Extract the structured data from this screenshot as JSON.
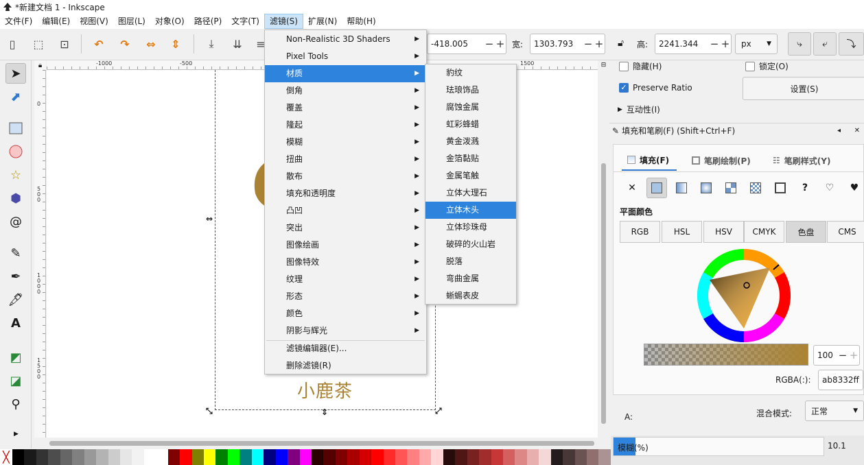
{
  "window": {
    "title": "*新建文档 1 - Inkscape"
  },
  "menubar": [
    "文件(F)",
    "编辑(E)",
    "视图(V)",
    "图层(L)",
    "对象(O)",
    "路径(P)",
    "文字(T)",
    "滤镜(S)",
    "扩展(N)",
    "帮助(H)"
  ],
  "toolbar": {
    "x_value": "-418.005",
    "w_label": "宽:",
    "w_value": "1303.793",
    "h_label": "高:",
    "h_value": "2241.344",
    "unit": "px"
  },
  "rulers": {
    "h_ticks": [
      "-1000",
      "-500",
      "1500"
    ],
    "v_ticks": [
      "0",
      "500",
      "1000",
      "1500"
    ]
  },
  "canvas": {
    "text": "小鹿茶"
  },
  "filters_menu": {
    "items": [
      "Non-Realistic 3D Shaders",
      "Pixel Tools",
      "材质",
      "倒角",
      "覆盖",
      "隆起",
      "模糊",
      "扭曲",
      "散布",
      "填充和透明度",
      "凸凹",
      "突出",
      "图像绘画",
      "图像特效",
      "纹理",
      "形态",
      "颜色",
      "阴影与辉光"
    ],
    "editor": "滤镜编辑器(E)...",
    "remove": "删除滤镜(R)",
    "highlighted": "材质"
  },
  "materials_submenu": {
    "items": [
      "豹纹",
      "珐琅饰品",
      "腐蚀金属",
      "虹彩蜂蜡",
      "黄金泼溅",
      "金箔黏贴",
      "金属笔触",
      "立体大理石",
      "立体木头",
      "立体珍珠母",
      "破碎的火山岩",
      "脱落",
      "弯曲金属",
      "蜥蜴表皮"
    ],
    "highlighted": "立体木头"
  },
  "object_props": {
    "hide": "隐藏(H)",
    "lock": "锁定(O)",
    "preserve_ratio": "Preserve Ratio",
    "settings": "设置(S)",
    "interactivity": "互动性(I)"
  },
  "fill_stroke": {
    "title": "填充和笔刷(F) (Shift+Ctrl+F)",
    "tabs": [
      "填充(F)",
      "笔刷绘制(P)",
      "笔刷样式(Y)"
    ],
    "flat_color": "平面颜色",
    "color_modes": [
      "RGB",
      "HSL",
      "HSV",
      "CMYK",
      "色盘",
      "CMS"
    ],
    "alpha_label": "A:",
    "alpha_value": "100",
    "rgba_label": "RGBA(:):",
    "rgba_value": "ab8332ff",
    "blend_label": "混合模式:",
    "blend_value": "正常",
    "blur_label": "模糊(%)",
    "opacity_value": "10.1"
  },
  "colors": {
    "accent": "#2e84dd",
    "fill": "#ab8332"
  },
  "palette": [
    "#000000",
    "#1a1a1a",
    "#333333",
    "#4d4d4d",
    "#666666",
    "#808080",
    "#999999",
    "#b3b3b3",
    "#cccccc",
    "#e6e6e6",
    "#f2f2f2",
    "#ffffff",
    "#ffffff",
    "#800000",
    "#ff0000",
    "#808000",
    "#ffff00",
    "#008000",
    "#00ff00",
    "#008080",
    "#00ffff",
    "#000080",
    "#0000ff",
    "#800080",
    "#ff00ff",
    "#2b0000",
    "#550000",
    "#800000",
    "#aa0000",
    "#d40000",
    "#ff0000",
    "#ff2a2a",
    "#ff5555",
    "#ff8080",
    "#ffaaaa",
    "#ffd5d5",
    "#280b0b",
    "#501616",
    "#782121",
    "#a02c2c",
    "#c83737",
    "#d35f5f",
    "#de8787",
    "#e9afaf",
    "#f4d7d7",
    "#241c1c",
    "#483737",
    "#6c5353",
    "#916f6f",
    "#ac9393"
  ]
}
